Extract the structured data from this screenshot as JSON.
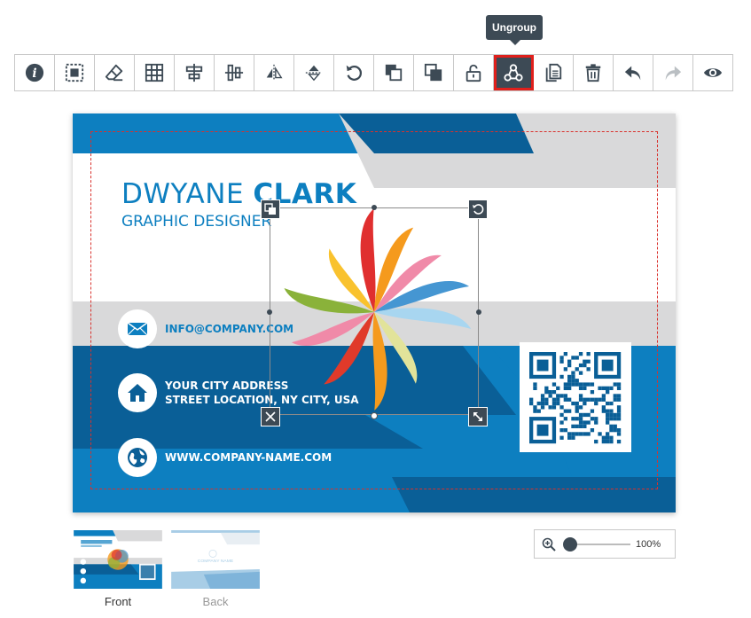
{
  "tooltip": "Ungroup",
  "toolbar": {
    "buttons": [
      {
        "name": "info-icon"
      },
      {
        "name": "select-all-icon"
      },
      {
        "name": "eraser-icon"
      },
      {
        "name": "grid-icon"
      },
      {
        "name": "align-center-horizontal-icon"
      },
      {
        "name": "align-center-vertical-icon"
      },
      {
        "name": "flip-horizontal-icon"
      },
      {
        "name": "flip-vertical-icon"
      },
      {
        "name": "rotate-icon"
      },
      {
        "name": "send-backward-icon"
      },
      {
        "name": "bring-forward-icon"
      },
      {
        "name": "lock-icon"
      },
      {
        "name": "ungroup-icon"
      },
      {
        "name": "duplicate-icon"
      },
      {
        "name": "trash-icon"
      },
      {
        "name": "undo-icon"
      },
      {
        "name": "redo-icon"
      },
      {
        "name": "preview-eye-icon"
      }
    ]
  },
  "card": {
    "first_name": "DWYANE ",
    "last_name": "CLARK",
    "job_title": "GRAPHIC DESIGNER",
    "email": "INFO@COMPANY.COM",
    "address_line1": "YOUR CITY ADDRESS",
    "address_line2": "STREET LOCATION, NY CITY, USA",
    "website": "WWW.COMPANY-NAME.COM"
  },
  "thumbnails": {
    "front_label": "Front",
    "back_label": "Back",
    "back_logo_text": "COMPANY NAME"
  },
  "zoom": {
    "value": "100%",
    "level_percent": 100
  },
  "colors": {
    "brand_blue": "#0d7fc0",
    "dark_blue": "#0a5f97",
    "gray_stripe": "#d9d9da",
    "toolbar_dark": "#3d4a55",
    "highlight_red": "#e0201c"
  }
}
